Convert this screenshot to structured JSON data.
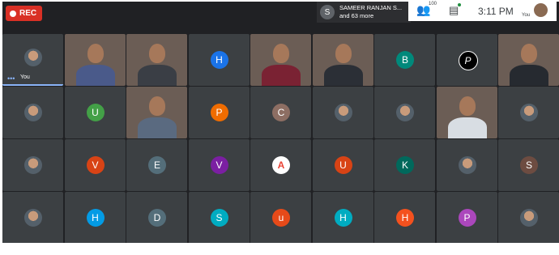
{
  "recording": {
    "label": "REC"
  },
  "presenter": {
    "initial": "S",
    "name": "SAMEER RANJAN S...",
    "more": "and 63 more"
  },
  "controls": {
    "participants_count": "100",
    "time": "3:11 PM",
    "self_label": "You"
  },
  "self_tile": {
    "label": "You",
    "dots": "•••"
  },
  "tiles": [
    {
      "kind": "photo"
    },
    {
      "kind": "cam",
      "shirt": "#4a5a8a"
    },
    {
      "kind": "cam",
      "shirt": "#3a3e45"
    },
    {
      "kind": "letter",
      "letter": "H",
      "color": "#1a73e8"
    },
    {
      "kind": "cam",
      "shirt": "#7a2233"
    },
    {
      "kind": "cam",
      "shirt": "#2b2f36"
    },
    {
      "kind": "letter",
      "letter": "B",
      "color": "#00897b"
    },
    {
      "kind": "letter",
      "letter": "P",
      "color": "#000000"
    },
    {
      "kind": "cam",
      "shirt": "#262a30"
    },
    {
      "kind": "photo"
    },
    {
      "kind": "letter",
      "letter": "U",
      "color": "#43a047"
    },
    {
      "kind": "cam",
      "shirt": "#5a6a80"
    },
    {
      "kind": "letter",
      "letter": "P",
      "color": "#ef6c00"
    },
    {
      "kind": "letter",
      "letter": "C",
      "color": "#8d6e63"
    },
    {
      "kind": "photo"
    },
    {
      "kind": "photo"
    },
    {
      "kind": "cam",
      "shirt": "#d8dde3"
    },
    {
      "kind": "photo"
    },
    {
      "kind": "photo"
    },
    {
      "kind": "letter",
      "letter": "V",
      "color": "#d84315"
    },
    {
      "kind": "letter",
      "letter": "E",
      "color": "#546e7a"
    },
    {
      "kind": "letter",
      "letter": "V",
      "color": "#7b1fa2"
    },
    {
      "kind": "letter",
      "letter": "A",
      "color": "#ffffff"
    },
    {
      "kind": "letter",
      "letter": "U",
      "color": "#d84315"
    },
    {
      "kind": "letter",
      "letter": "K",
      "color": "#00695c"
    },
    {
      "kind": "photo"
    },
    {
      "kind": "letter",
      "letter": "S",
      "color": "#6d4c41"
    },
    {
      "kind": "photo"
    },
    {
      "kind": "letter",
      "letter": "H",
      "color": "#039be5"
    },
    {
      "kind": "letter",
      "letter": "D",
      "color": "#546e7a"
    },
    {
      "kind": "letter",
      "letter": "S",
      "color": "#00acc1"
    },
    {
      "kind": "letter",
      "letter": "u",
      "color": "#e64a19"
    },
    {
      "kind": "letter",
      "letter": "H",
      "color": "#00acc1"
    },
    {
      "kind": "letter",
      "letter": "H",
      "color": "#f4511e"
    },
    {
      "kind": "letter",
      "letter": "P",
      "color": "#ab47bc"
    },
    {
      "kind": "photo"
    }
  ]
}
